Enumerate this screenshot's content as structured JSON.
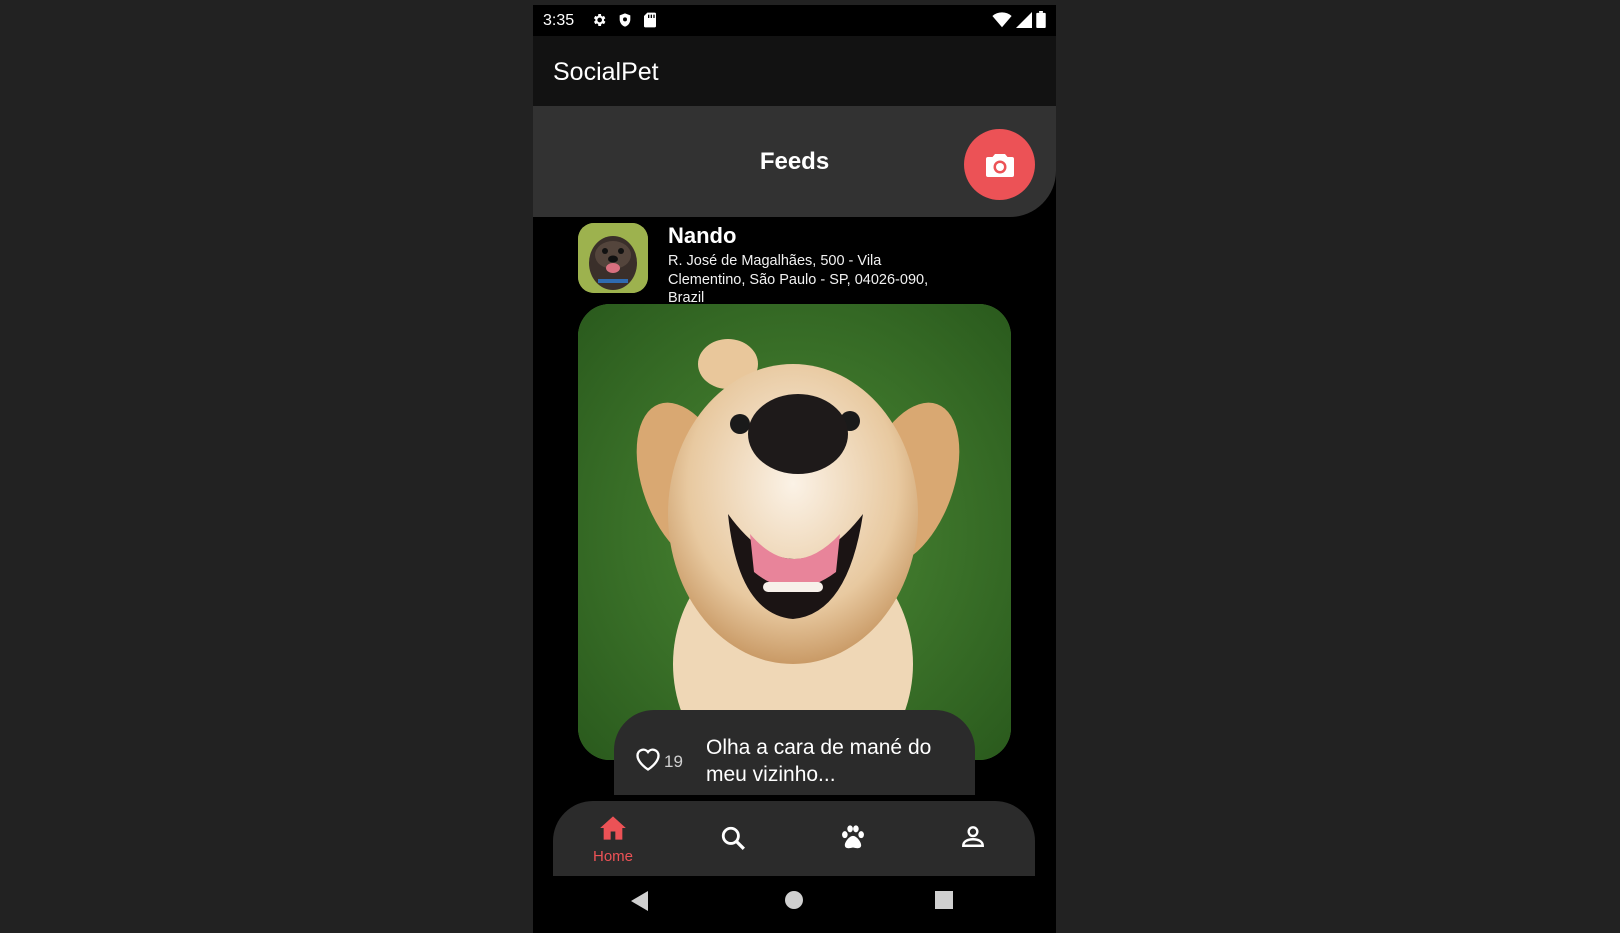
{
  "status_bar": {
    "time": "3:35",
    "left_icons": [
      "gear-icon",
      "shield-icon",
      "sd-card-icon"
    ],
    "right_icons": [
      "wifi-icon",
      "signal-icon",
      "battery-icon"
    ]
  },
  "app_bar": {
    "title": "SocialPet"
  },
  "feeds_header": {
    "title": "Feeds",
    "camera_icon": "camera-icon"
  },
  "post": {
    "author": "Nando",
    "address": "R. José de Magalhães, 500 - Vila Clementino, São Paulo - SP, 04026-090, Brazil",
    "image_description": "dog-photo",
    "likes": "19",
    "caption": "Olha a cara de mané do meu vizinho..."
  },
  "bottom_nav": {
    "items": [
      {
        "icon": "home-icon",
        "label": "Home",
        "active": true
      },
      {
        "icon": "search-icon",
        "label": "",
        "active": false
      },
      {
        "icon": "paw-icon",
        "label": "",
        "active": false
      },
      {
        "icon": "person-icon",
        "label": "",
        "active": false
      }
    ]
  },
  "system_nav": {
    "buttons": [
      "back-icon",
      "home-circle-icon",
      "recents-icon"
    ]
  },
  "colors": {
    "accent": "#ec5256",
    "background": "#000000",
    "surface": "#2b2b2b"
  }
}
